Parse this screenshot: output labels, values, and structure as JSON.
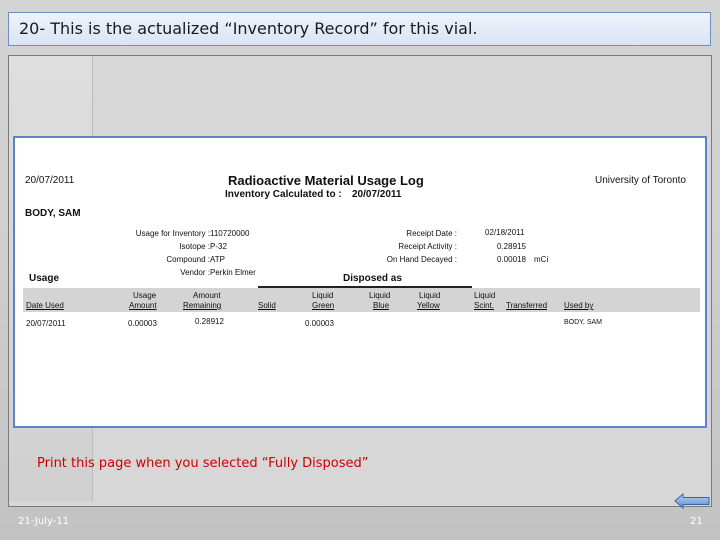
{
  "slide": {
    "title": "20- This is the actualized “Inventory Record” for this vial.",
    "note": "Print this page when you selected “Fully Disposed”",
    "footer_date": "21-July-11",
    "page_number": "21",
    "nav_icon": "back-arrow-icon"
  },
  "report": {
    "print_date": "20/07/2011",
    "title": "Radioactive Material Usage Log",
    "subtitle_label": "Inventory Calculated to :",
    "subtitle_date": "20/07/2011",
    "institution": "University of Toronto",
    "person": "BODY, SAM",
    "fields_left": [
      {
        "label": "Usage for Inventory :",
        "value": "110720000"
      },
      {
        "label": "Isotope :",
        "value": "P-32"
      },
      {
        "label": "Compound :",
        "value": "ATP"
      },
      {
        "label": "Vendor :",
        "value": "Perkin Elmer"
      }
    ],
    "fields_right": [
      {
        "label": "Receipt Date :",
        "value": "02/18/2011"
      },
      {
        "label": "Receipt Activity :",
        "value": "0.28915"
      },
      {
        "label": "On Hand Decayed :",
        "value": "0.00018",
        "unit": "mCi"
      }
    ],
    "usage_heading": "Usage",
    "disposed_heading": "Disposed as",
    "columns": {
      "date_used": "Date Used",
      "usage_top": "Usage",
      "usage_bottom": "Amount",
      "amount_top": "Amount",
      "amount_bottom": "Remaining",
      "solid": "Solid",
      "lg_top": "Liquid",
      "lg_bottom": "Green",
      "lb_top": "Liquid",
      "lb_bottom": "Blue",
      "ly_top": "Liquid",
      "ly_bottom": "Yellow",
      "ls_top": "Liquid",
      "ls_bottom": "Scint.",
      "transferred": "Transferred",
      "used_by": "Used by"
    },
    "row": {
      "date_used": "20/07/2011",
      "usage_amount": "0.00003",
      "amount_remaining": "0.28912",
      "liquid_green": "0.00003",
      "used_by": "BODY, SAM"
    }
  }
}
